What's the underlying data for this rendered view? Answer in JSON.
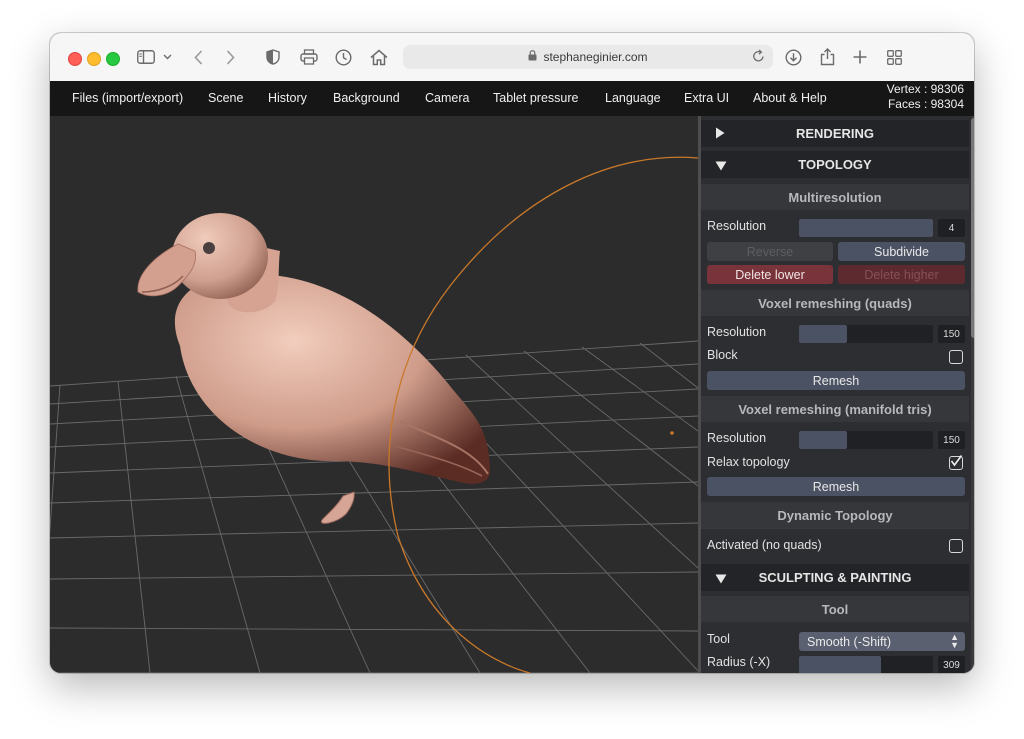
{
  "browser": {
    "url": "stephaneginier.com",
    "toolbar_icons": [
      "sidebar-icon",
      "chevron-down-icon",
      "back-icon",
      "forward-icon",
      "shield-icon",
      "printer-icon",
      "clock-icon",
      "home-icon",
      "download-icon",
      "share-icon",
      "plus-icon",
      "tabs-grid-icon"
    ]
  },
  "menu": {
    "items": [
      "Files (import/export)",
      "Scene",
      "History",
      "Background",
      "Camera",
      "Tablet pressure",
      "Language",
      "Extra UI",
      "About & Help"
    ],
    "vertex": "Vertex : 98306",
    "faces": "Faces : 98304"
  },
  "panel": {
    "rendering": "RENDERING",
    "topology": "TOPOLOGY",
    "multires": {
      "title": "Multiresolution",
      "resolution_label": "Resolution",
      "resolution_value": "4",
      "resolution_fraction": 1.0,
      "reverse": "Reverse",
      "subdivide": "Subdivide",
      "delete_lower": "Delete lower",
      "delete_higher": "Delete higher"
    },
    "voxel_quads": {
      "title": "Voxel remeshing (quads)",
      "resolution_label": "Resolution",
      "resolution_value": "150",
      "resolution_fraction": 0.36,
      "block_label": "Block",
      "block_checked": false,
      "remesh": "Remesh"
    },
    "voxel_tris": {
      "title": "Voxel remeshing (manifold tris)",
      "resolution_label": "Resolution",
      "resolution_value": "150",
      "resolution_fraction": 0.36,
      "relax_label": "Relax topology",
      "relax_checked": true,
      "remesh": "Remesh"
    },
    "dynamic": {
      "title": "Dynamic Topology",
      "activated_label": "Activated (no quads)",
      "activated_checked": false
    },
    "sculpting": "SCULPTING & PAINTING",
    "tool": {
      "title": "Tool",
      "tool_label": "Tool",
      "tool_value": "Smooth (-Shift)",
      "radius_label": "Radius (-X)",
      "radius_value": "309",
      "radius_fraction": 0.61
    }
  },
  "colors": {
    "accent": "#4b5263",
    "danger": "#79333a",
    "brush_circle": "#c8782a",
    "model": "#d8a494"
  }
}
